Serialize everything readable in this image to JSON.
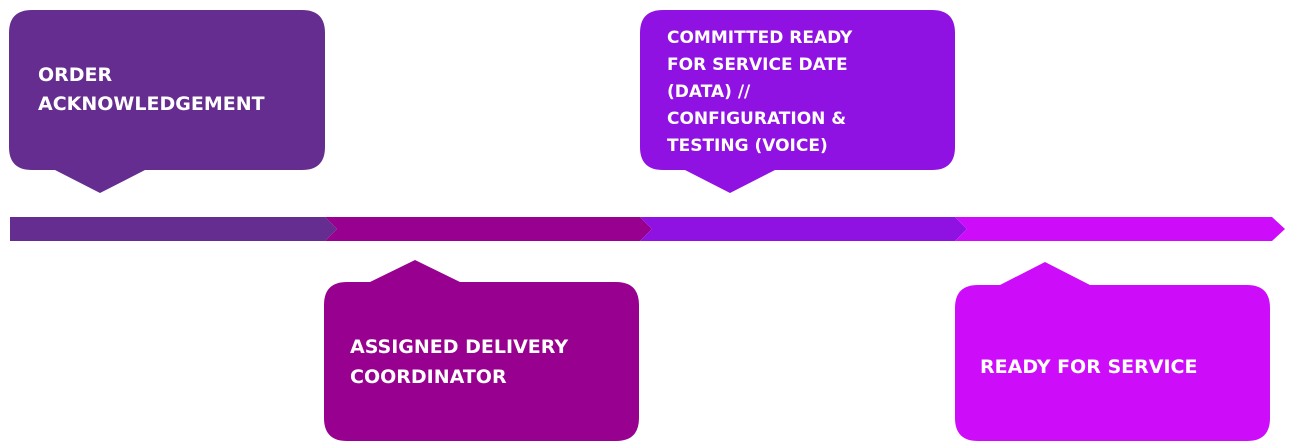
{
  "timeline": {
    "colors": {
      "segment_1": "#652d90",
      "segment_2": "#98018f",
      "segment_3": "#9012e3",
      "segment_4": "#cd0cfa",
      "text": "#ffffff",
      "background": "#ffffff"
    },
    "stages": [
      {
        "name": "stage-order-acknowledgement",
        "position": "above",
        "lines": [
          "ORDER",
          "ACKNOWLEDGEMENT"
        ]
      },
      {
        "name": "stage-assigned-delivery-coordinator",
        "position": "below",
        "lines": [
          "ASSIGNED DELIVERY",
          "COORDINATOR"
        ]
      },
      {
        "name": "stage-committed-ready-for-service-date",
        "position": "above",
        "lines": [
          "COMMITTED READY",
          "FOR SERVICE DATE",
          "(DATA) //",
          "CONFIGURATION &",
          "TESTING (VOICE)"
        ]
      },
      {
        "name": "stage-ready-for-service",
        "position": "below",
        "lines": [
          "READY FOR SERVICE"
        ]
      }
    ]
  }
}
